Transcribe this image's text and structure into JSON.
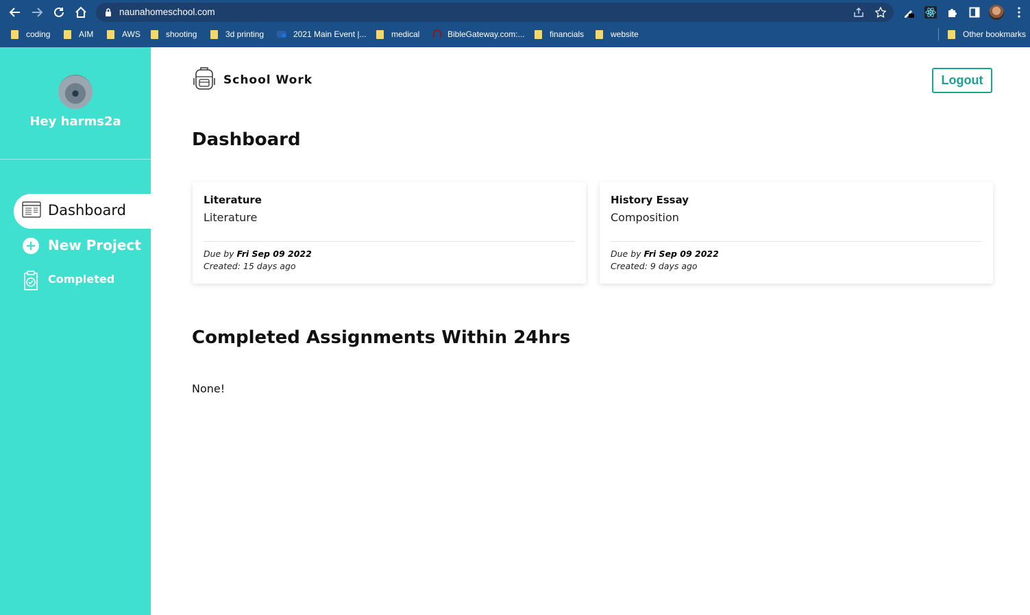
{
  "browser": {
    "url": "naunahomeschool.com",
    "bookmarks": [
      {
        "label": "coding",
        "icon": "folder-icon"
      },
      {
        "label": "AIM",
        "icon": "folder-icon"
      },
      {
        "label": "AWS",
        "icon": "folder-icon"
      },
      {
        "label": "shooting",
        "icon": "folder-icon"
      },
      {
        "label": "3d printing",
        "icon": "folder-icon"
      },
      {
        "label": "2021 Main Event |...",
        "icon": "site-icon"
      },
      {
        "label": "medical",
        "icon": "folder-icon"
      },
      {
        "label": "BibleGateway.com:...",
        "icon": "site-icon"
      },
      {
        "label": "financials",
        "icon": "folder-icon"
      },
      {
        "label": "website",
        "icon": "folder-icon"
      }
    ],
    "other_bookmarks": "Other bookmarks",
    "colors": {
      "chrome": "#1b4f88",
      "omnibox": "#1d3f6b"
    }
  },
  "sidebar": {
    "greeting": "Hey harms2a",
    "nav": [
      {
        "label": "Dashboard",
        "active": true,
        "icon": "dashboard-icon"
      },
      {
        "label": "New Project",
        "active": false,
        "icon": "plus-circle-icon"
      },
      {
        "label": "Completed",
        "active": false,
        "icon": "clipboard-check-icon"
      }
    ],
    "color": "#40e0d0"
  },
  "header": {
    "brand": "School Work",
    "logout": "Logout",
    "accent": "#1aa294"
  },
  "dashboard": {
    "title": "Dashboard",
    "cards": [
      {
        "title": "Literature",
        "subject": "Literature",
        "due_prefix": "Due by ",
        "due_date": "Fri Sep 09 2022",
        "created": "Created: 15 days ago"
      },
      {
        "title": "History Essay",
        "subject": "Composition",
        "due_prefix": "Due by ",
        "due_date": "Fri Sep 09 2022",
        "created": "Created: 9 days ago"
      }
    ]
  },
  "completed": {
    "title": "Completed Assignments Within 24hrs",
    "empty_text": "None!"
  }
}
